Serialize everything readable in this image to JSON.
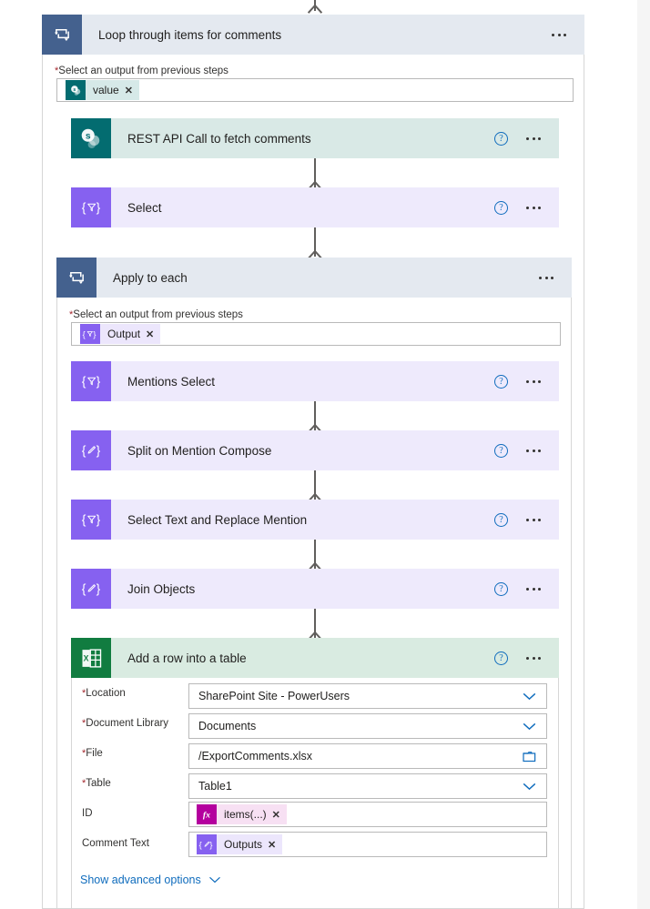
{
  "flow": {
    "outer_loop": {
      "title": "Loop through items for comments",
      "icon": "loop-foreach-icon",
      "input_label": "Select an output from previous steps",
      "token": {
        "text": "value",
        "icon": "sharepoint-icon",
        "remove": "✕"
      },
      "more": "more-commands"
    },
    "actions": {
      "rest_api": {
        "title": "REST API Call to fetch comments",
        "icon": "sharepoint-icon",
        "help": "?",
        "kind": "teal"
      },
      "select": {
        "title": "Select",
        "icon": "select-filter-icon",
        "help": "?",
        "kind": "purple"
      },
      "mentions_select": {
        "title": "Mentions Select",
        "icon": "select-filter-icon",
        "help": "?",
        "kind": "purple"
      },
      "split_compose": {
        "title": "Split on Mention Compose",
        "icon": "compose-pencil-icon",
        "help": "?",
        "kind": "purple"
      },
      "select_replace": {
        "title": "Select Text and Replace Mention",
        "icon": "select-filter-icon",
        "help": "?",
        "kind": "purple"
      },
      "join_objects": {
        "title": "Join Objects",
        "icon": "compose-pencil-icon",
        "help": "?",
        "kind": "purple"
      },
      "add_row": {
        "title": "Add a row into a table",
        "icon": "excel-icon",
        "help": "?",
        "kind": "green"
      }
    },
    "inner_loop": {
      "title": "Apply to each",
      "icon": "loop-foreach-icon",
      "input_label": "Select an output from previous steps",
      "token": {
        "text": "Output",
        "icon": "compose-select-icon",
        "remove": "✕"
      },
      "more": "more-commands"
    },
    "excel_form": {
      "fields": [
        {
          "label": "Location",
          "required": true,
          "value": "SharePoint Site - PowerUsers",
          "control": "dropdown"
        },
        {
          "label": "Document Library",
          "required": true,
          "value": "Documents",
          "control": "dropdown"
        },
        {
          "label": "File",
          "required": true,
          "value": "/ExportComments.xlsx",
          "control": "filepicker"
        },
        {
          "label": "Table",
          "required": true,
          "value": "Table1",
          "control": "dropdown"
        },
        {
          "label": "ID",
          "required": false,
          "token": {
            "text": "items(...)",
            "icon": "expression-fx-icon",
            "remove": "✕"
          },
          "control": "token"
        },
        {
          "label": "Comment Text",
          "required": false,
          "token": {
            "text": "Outputs",
            "icon": "compose-pencil-icon",
            "remove": "✕"
          },
          "control": "token"
        }
      ],
      "advanced_link": "Show advanced options",
      "required_marker": "*"
    },
    "colors": {
      "scope_header": "#e4e9f0",
      "scope_icon": "#44618e",
      "purple": "#8661f0",
      "purple_card": "#eeeafc",
      "teal": "#036c70",
      "teal_card": "#d9e9e6",
      "green": "#117c40",
      "green_card": "#d9ebe1",
      "magenta": "#b4009e",
      "link": "#0f6cbd",
      "required": "#a4262c",
      "arrow": "#605e5c"
    }
  }
}
